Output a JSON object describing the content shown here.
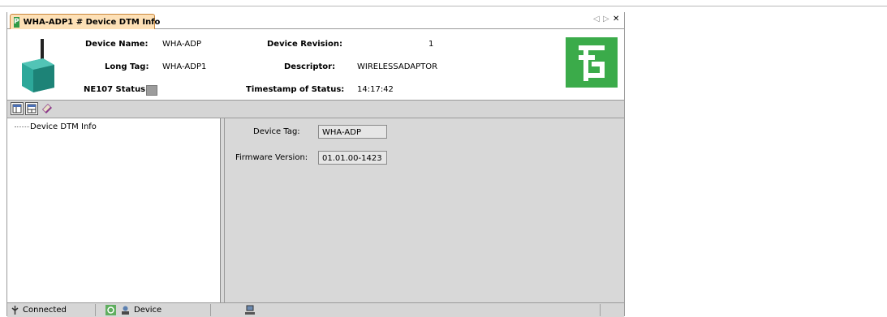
{
  "tab": {
    "title": "WHA-ADP1 # Device DTM Info",
    "logo_text": "P"
  },
  "header": {
    "device_name_label": "Device Name:",
    "device_name": "WHA-ADP",
    "long_tag_label": "Long Tag:",
    "long_tag": "WHA-ADP1",
    "ne107_label": "NE107 Status:",
    "device_revision_label": "Device Revision:",
    "device_revision": "1",
    "descriptor_label": "Descriptor:",
    "descriptor": "WIRELESSADAPTOR",
    "timestamp_label": "Timestamp of Status:",
    "timestamp": "14:17:42"
  },
  "tree": {
    "items": [
      "Device DTM Info"
    ]
  },
  "details": {
    "device_tag_label": "Device Tag:",
    "device_tag": "WHA-ADP",
    "firmware_label": "Firmware Version:",
    "firmware": "01.01.00-1423"
  },
  "statusbar": {
    "connection": "Connected",
    "mode": "Device"
  },
  "colors": {
    "tab_bg": "#fde0b6",
    "brand_green": "#3bab4a",
    "pane_gray": "#d8d8d8"
  },
  "icons": [
    "pepperl-fuchs-logo",
    "nav-left-icon",
    "nav-right-icon",
    "close-icon",
    "layout-icon",
    "layout-alt-icon",
    "book-icon",
    "connected-icon",
    "refresh-icon",
    "device-icon",
    "network-icon"
  ]
}
